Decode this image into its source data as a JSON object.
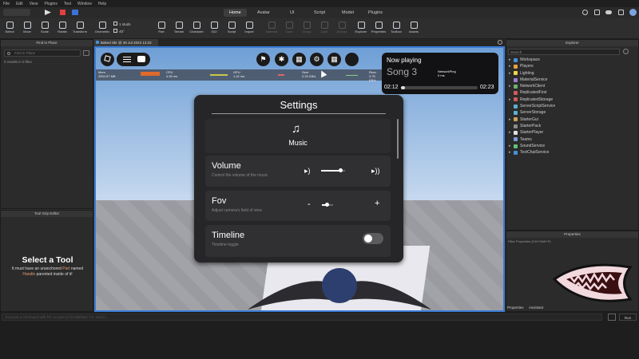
{
  "menubar": {
    "items": [
      "File",
      "Edit",
      "View",
      "Plugins",
      "Test",
      "Window",
      "Help"
    ]
  },
  "ribbon": {
    "tabs": [
      "Home",
      "Avatar",
      "UI",
      "Script",
      "Model",
      "Plugins"
    ]
  },
  "toolbar": {
    "tools": [
      "Select",
      "Move",
      "Scale",
      "Rotate",
      "Transform",
      "Geometric",
      "Part",
      "Terrain",
      "Character",
      "GUI",
      "Script",
      "Import",
      "Material",
      "Color",
      "Group",
      "Lock",
      "Anchor",
      "Explorer",
      "Properties",
      "Toolbox",
      "Assets"
    ],
    "collisions_label": "1 studs",
    "rotate_label": "45°"
  },
  "left_panels": {
    "find_title": "Find in Place",
    "find_placeholder": "Find in Place",
    "results": "0 results in 0 files",
    "toolgrip_title": "Tool Grip Editor",
    "select_tool_title": "Select a Tool",
    "select_tool_desc_1": "It must have an unanchored",
    "select_tool_desc_part": "Part",
    "select_tool_desc_named": "named",
    "select_tool_desc_handle": "Handle",
    "select_tool_desc_2": "parented inside of it!"
  },
  "document_tab": {
    "label": "Baked Skr @ 30 Jul 2024 13:22"
  },
  "stats": [
    {
      "label": "Mem",
      "value": "3904.57 MB"
    },
    {
      "label": "CPU",
      "value": "4.55 ms"
    },
    {
      "label": "GPU",
      "value": "1.42 ms"
    },
    {
      "label": "Sent",
      "value": "0.23 KB/s"
    },
    {
      "label": "Recv",
      "value": "3.75 KB/s"
    }
  ],
  "network_ping": {
    "label": "NetworkPing",
    "value": "0 ms"
  },
  "now_playing": {
    "title": "Now playing",
    "song": "Song 3",
    "elapsed": "02:12",
    "total": "02:23",
    "progress": 0.05
  },
  "settings": {
    "title": "Settings",
    "category": "Music",
    "rows": [
      {
        "title": "Volume",
        "desc": "Control the volume of the music",
        "value": 0.82
      },
      {
        "title": "Fov",
        "desc": "Adjust camera's field of view",
        "minus": "-",
        "plus": "+",
        "value": 0.45
      },
      {
        "title": "Timeline",
        "desc": "Timeline toggle",
        "enabled": true
      }
    ]
  },
  "explorer": {
    "title": "Explorer",
    "filter_placeholder": "Search",
    "items": [
      {
        "name": "Workspace",
        "color": "#4a90d9",
        "indent": 0,
        "arrow": true
      },
      {
        "name": "Players",
        "color": "#e9a33d",
        "indent": 0,
        "arrow": true
      },
      {
        "name": "Lighting",
        "color": "#f2d24b",
        "indent": 0,
        "arrow": true
      },
      {
        "name": "MaterialService",
        "color": "#9b7fd1",
        "indent": 0,
        "arrow": false
      },
      {
        "name": "NetworkClient",
        "color": "#6fb06f",
        "indent": 0,
        "arrow": true
      },
      {
        "name": "ReplicatedFirst",
        "color": "#d05a5a",
        "indent": 0,
        "arrow": false
      },
      {
        "name": "ReplicatedStorage",
        "color": "#d05a5a",
        "indent": 0,
        "arrow": true
      },
      {
        "name": "ServerScriptService",
        "color": "#5ab0d0",
        "indent": 0,
        "arrow": false
      },
      {
        "name": "ServerStorage",
        "color": "#5ab0d0",
        "indent": 0,
        "arrow": false
      },
      {
        "name": "StarterGui",
        "color": "#d0a35a",
        "indent": 0,
        "arrow": true
      },
      {
        "name": "StarterPack",
        "color": "#8c8c8c",
        "indent": 0,
        "arrow": false
      },
      {
        "name": "StarterPlayer",
        "color": "#e0e0e0",
        "indent": 0,
        "arrow": true
      },
      {
        "name": "Teams",
        "color": "#7d9ad6",
        "indent": 0,
        "arrow": false
      },
      {
        "name": "SoundService",
        "color": "#5fc27a",
        "indent": 0,
        "arrow": true
      },
      {
        "name": "TextChatService",
        "color": "#4a90d9",
        "indent": 0,
        "arrow": true
      }
    ]
  },
  "properties": {
    "title": "Properties",
    "filter_placeholder": "Filter Properties (Ctrl+Shift+P)",
    "tabs": [
      "Properties",
      "Assistant"
    ]
  },
  "command_bar": {
    "placeholder": "Execute a command with F9: xx=pos (17)/Add/New: Fn: sss(1)..."
  },
  "bottom_right": {
    "run_label": "Run"
  }
}
